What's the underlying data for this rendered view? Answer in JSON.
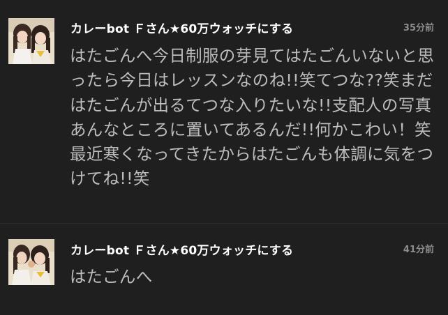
{
  "messages": [
    {
      "author": "カレーbot Ｆさん★60万ウォッチにする",
      "time": "35分前",
      "avatar": "user-avatar-photo",
      "text": "はたごんへ今日制服の芽見てはたごんいないと思ったら今日はレッスンなのね!!笑てつな??笑まだはたごんが出るてつな入りたいな!!支配人の写真あんなところに置いてあるんだ!!何かこわい！笑最近寒くなってきたからはたごんも体調に気をつけてね!!笑"
    },
    {
      "author": "カレーbot Ｆさん★60万ウォッチにする",
      "time": "41分前",
      "avatar": "user-avatar-photo",
      "text": "はたごんへ"
    }
  ],
  "colors": {
    "background": "#1f1f1f",
    "author": "#ffffff",
    "body_text": "#bdbdbd",
    "timestamp": "#8c8c8c"
  }
}
